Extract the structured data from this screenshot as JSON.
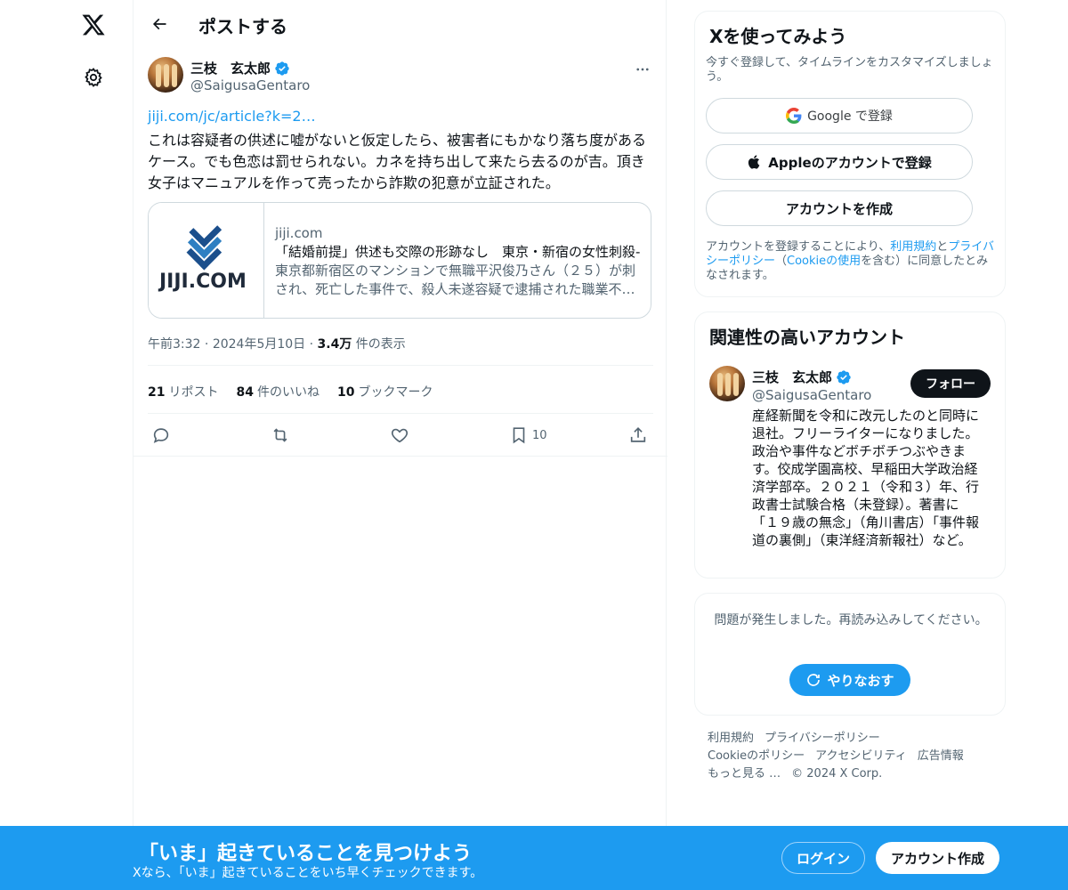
{
  "nav": {
    "logo_icon": "x-logo-icon",
    "settings_icon": "gear-icon"
  },
  "header": {
    "title": "ポストする",
    "back_icon": "arrow-left-icon"
  },
  "post": {
    "author_name": "三枝　玄太郎",
    "author_handle": "@SaigusaGentaro",
    "link_text": "jiji.com/jc/article?k=2…",
    "text": "これは容疑者の供述に嘘がないと仮定したら、被害者にもかなり落ち度があるケース。でも色恋は罰せられない。カネを持ち出して来たら去るのが吉。頂き女子はマニュアルを作って売ったから詐欺の犯意が立証された。",
    "card": {
      "logo_text": "JIJI.COM",
      "domain": "jiji.com",
      "title": "「結婚前提」供述も交際の形跡なし　東京・新宿の女性刺殺-",
      "description": "東京都新宿区のマンションで無職平沢俊乃さん（２５）が刺され、死亡した事件で、殺人未遂容疑で逮捕された職業不…"
    },
    "time": "午前3:32",
    "date": "2024年5月10日",
    "views_count": "3.4万",
    "views_label": "件の表示",
    "reposts_count": "21",
    "reposts_label": "リポスト",
    "likes_count": "84",
    "likes_label": "件のいいね",
    "bookmarks_count": "10",
    "bookmarks_label": "ブックマーク",
    "bookmark_action_count": "10",
    "colors": {
      "link": "#1d9bf0",
      "verified": "#1d9bf0"
    }
  },
  "signup_box": {
    "title": "Xを使ってみよう",
    "subtitle": "今すぐ登録して、タイムラインをカスタマイズしましょう。",
    "google_label": "Google で登録",
    "apple_label": "Appleのアカウントで登録",
    "create_label": "アカウントを作成",
    "legal_1": "アカウントを登録することにより、",
    "legal_terms": "利用規約",
    "legal_2": "と",
    "legal_privacy": "プライバシーポリシー",
    "legal_3": "（",
    "legal_cookie": "Cookieの使用",
    "legal_4": "を含む）に同意したとみなされます。"
  },
  "related_box": {
    "title": "関連性の高いアカウント",
    "name": "三枝　玄太郎",
    "handle": "@SaigusaGentaro",
    "follow_label": "フォロー",
    "bio": "産経新聞を令和に改元したのと同時に退社。フリーライターになりました。政治や事件などボチボチつぶやきます。佼成学園高校、早稲田大学政治経済学部卒。２０２１（令和３）年、行政書士試験合格（未登録）。著書に「１９歳の無念」（角川書店）「事件報道の裏側」（東洋経済新報社）など。"
  },
  "error_box": {
    "message": "問題が発生しました。再読み込みしてください。",
    "retry_label": "やりなおす"
  },
  "footer": {
    "links": [
      "利用規約",
      "プライバシーポリシー",
      "Cookieのポリシー",
      "アクセシビリティ",
      "広告情報",
      "もっと見る …"
    ],
    "copyright": "© 2024 X Corp."
  },
  "banner": {
    "title": "「いま」起きていることを見つけよう",
    "subtitle": "Xなら、「いま」起きていることをいち早くチェックできます。",
    "login_label": "ログイン",
    "signup_label": "アカウント作成",
    "color": "#1d9bf0"
  }
}
